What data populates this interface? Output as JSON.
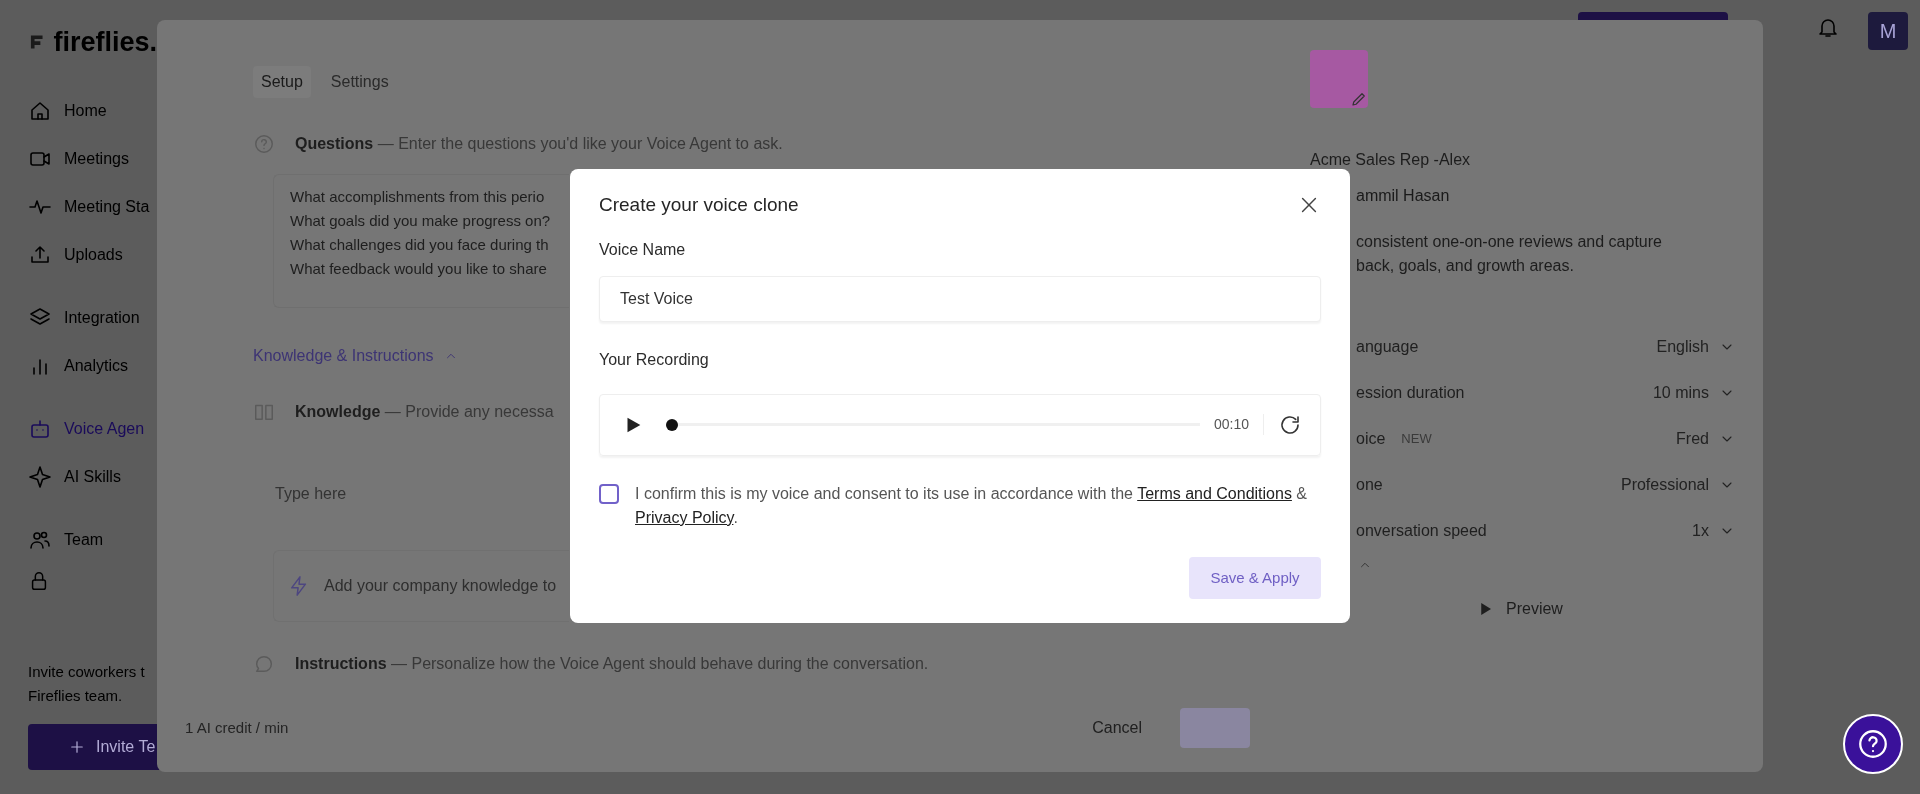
{
  "app": {
    "logo": "fireflies.",
    "nav": [
      {
        "label": "Home",
        "selected": false
      },
      {
        "label": "Meetings",
        "selected": false
      },
      {
        "label": "Meeting Sta",
        "selected": false
      },
      {
        "label": "Uploads",
        "selected": false
      },
      {
        "label": "Integration",
        "selected": false
      },
      {
        "label": "Analytics",
        "selected": false
      },
      {
        "label": "Voice Agen",
        "selected": true
      },
      {
        "label": "AI Skills",
        "selected": false
      },
      {
        "label": "Team",
        "selected": false
      }
    ],
    "invite_text": [
      "Invite coworkers t",
      "Fireflies team."
    ],
    "invite_button": "Invite Te",
    "avatar": "M"
  },
  "agent_editor": {
    "tabs": [
      {
        "label": "Setup",
        "selected": true
      },
      {
        "label": "Settings",
        "selected": false
      }
    ],
    "questions": {
      "title": "Questions",
      "description": "— Enter the questions you'd like your Voice Agent to ask."
    },
    "question_lines": [
      "What accomplishments from this perio",
      "What goals did you make progress on?",
      "What challenges did you face during th",
      "What feedback would you like to share"
    ],
    "knowledge_toggle": {
      "label": "Knowledge & Instructions",
      "expanded": true
    },
    "knowledge": {
      "title": "Knowledge",
      "description": "— Provide any necessa"
    },
    "knowledge_placeholder": "Type here",
    "knowledge_hint": "Add your company knowledge to",
    "instructions": {
      "title": "Instructions",
      "description": "— Personalize how the Voice Agent should behave during the conversation."
    },
    "credit": "1 AI credit / min",
    "cancel": "Cancel",
    "profile": {
      "name": "Acme Sales Rep -Alex",
      "owner": "ammil Hasan",
      "description": [
        "consistent one-on-one reviews and capture",
        "back, goals, and growth areas."
      ]
    },
    "settings": [
      {
        "label": "anguage",
        "value": "English"
      },
      {
        "label": "ession duration",
        "value": "10 mins"
      },
      {
        "label": "oice",
        "badge": "NEW",
        "value": "Fred"
      },
      {
        "label": "one",
        "value": "Professional"
      },
      {
        "label": "onversation speed",
        "value": "1x"
      }
    ],
    "advanced_expanded": true,
    "preview": "Preview"
  },
  "dialog": {
    "title": "Create your voice clone",
    "voice_name_label": "Voice Name",
    "voice_name": "Test Voice",
    "recording_label": "Your Recording",
    "player": {
      "level": 0,
      "time": "00:10"
    },
    "consent": {
      "checked": false,
      "text": "I confirm this is my voice and consent to its use in accordance with the ",
      "terms": "Terms and Conditions",
      "joiner": " & ",
      "privacy": "Privacy Policy",
      "end": "."
    },
    "save": {
      "label": "Save & Apply",
      "disabled": true
    }
  }
}
